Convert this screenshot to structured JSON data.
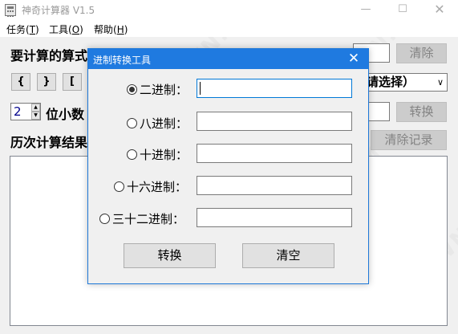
{
  "window": {
    "title": "神奇计算器 V1.5",
    "controls": {
      "minimize": "—",
      "maximize": "☐",
      "close": "✕"
    }
  },
  "menu": [
    {
      "label": "任务(",
      "key": "T",
      "suffix": ")"
    },
    {
      "label": "工具(",
      "key": "O",
      "suffix": ")"
    },
    {
      "label": "帮助(",
      "key": "H",
      "suffix": ")"
    }
  ],
  "main": {
    "expression_label": "要计算的算式",
    "clear_button": "清除",
    "brackets": [
      "{",
      "}",
      "["
    ],
    "select_value": "请选择）",
    "spin_value": "2",
    "decimal_label": "位小数",
    "convert_button": "转换",
    "history_label": "历次计算结果",
    "clear_history_button": "清除记录"
  },
  "watermark": "WEIDOWN.COM",
  "dialog": {
    "title": "进制转换工具",
    "close": "✕",
    "rows": [
      {
        "label": "二进制：",
        "checked": true,
        "value": ""
      },
      {
        "label": "八进制：",
        "checked": false,
        "value": ""
      },
      {
        "label": "十进制：",
        "checked": false,
        "value": ""
      },
      {
        "label": "十六进制：",
        "checked": false,
        "value": ""
      },
      {
        "label": "三十二进制：",
        "checked": false,
        "value": ""
      }
    ],
    "convert_button": "转换",
    "clear_button": "清空"
  }
}
